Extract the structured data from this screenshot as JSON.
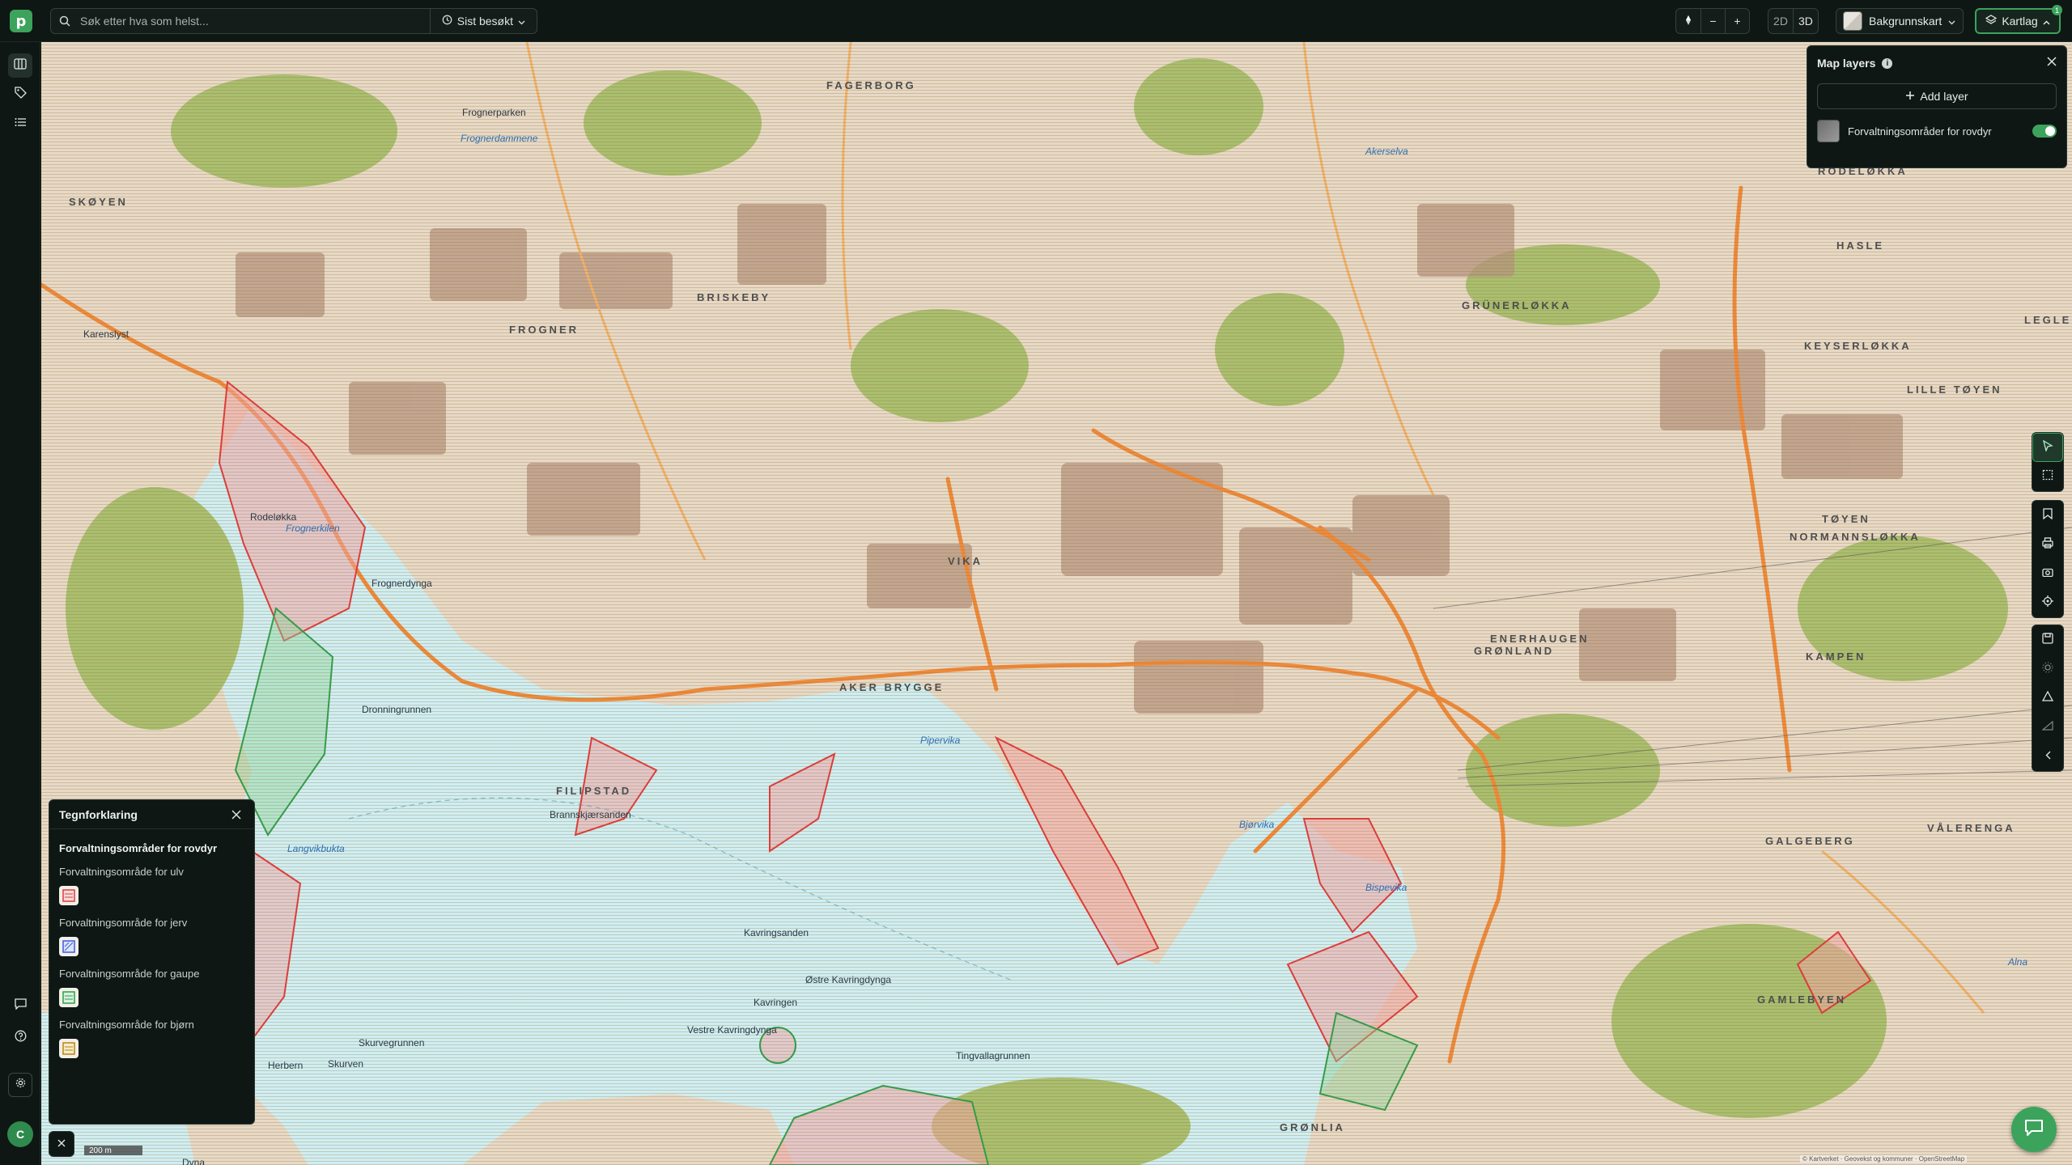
{
  "app": {
    "logo_letter": "p"
  },
  "search": {
    "placeholder": "Søk etter hva som helst...",
    "recent_label": "Sist besøkt"
  },
  "view": {
    "mode_2d": "2D",
    "mode_3d": "3D",
    "zoom_out": "−",
    "zoom_in": "+"
  },
  "basemap": {
    "label": "Bakgrunnskart"
  },
  "layers_button": {
    "label": "Kartlag",
    "badge": "1"
  },
  "layers_panel": {
    "title": "Map layers",
    "info_icon": "i",
    "add_label": "Add layer",
    "layers": [
      {
        "name": "Forvaltningsområder for rovdyr",
        "enabled": true
      }
    ]
  },
  "legend": {
    "title": "Tegnforklaring",
    "layer_title": "Forvaltningsområder for rovdyr",
    "items": [
      {
        "label": "Forvaltningsområde for ulv",
        "color": "#e03a3a"
      },
      {
        "label": "Forvaltningsområde for jerv",
        "color": "#3a5be0"
      },
      {
        "label": "Forvaltningsområde for gaupe",
        "color": "#2f9e4a"
      },
      {
        "label": "Forvaltningsområde for bjørn",
        "color": "#b8860b"
      }
    ]
  },
  "map": {
    "scale_label": "200 m",
    "attribution": "© Kartverket · Geovekst og kommuner · OpenStreetMap",
    "districts": [
      "SKØYEN",
      "FAGERBORG",
      "BRISKEBY",
      "FROGNER",
      "GRÜNERLØKKA",
      "RODELØKKA",
      "HASLE",
      "KEYSERLØKKA",
      "LILLE TØYEN",
      "TØYEN",
      "NORMANNSLØKKA",
      "ENERHAUGEN",
      "GRØNLAND",
      "KAMPEN",
      "VÅLERENGA",
      "GALGEBERG",
      "GAMLEBYEN",
      "AKER BRYGGE",
      "FILIPSTAD",
      "VIKA",
      "GRØNLIA",
      "LEGLE"
    ],
    "water": [
      "Frognerkilen",
      "Pipervika",
      "Bjørvika",
      "Bispevika",
      "Langvikbukta",
      "Alna",
      "Frognerdammene",
      "Akerselva"
    ],
    "places": [
      "Frognerdynga",
      "Dronningrunnen",
      "Kavringsanden",
      "Østre Kavringdynga",
      "Vestre Kavringdynga",
      "Kavringen",
      "Skurvegrunnen",
      "Skurven",
      "Tingvallagrunnen",
      "Herbern",
      "Brannskjærsanden",
      "Karenslyst",
      "Dyna",
      "Rodeløkka",
      "Frognerparken"
    ]
  },
  "colors": {
    "accent": "#3ca35c",
    "panel_bg": "#0f1714",
    "water": "#cfeef2",
    "land": "#e7d9c6",
    "park": "#a9bf6f",
    "road": "#ef8a3a"
  }
}
